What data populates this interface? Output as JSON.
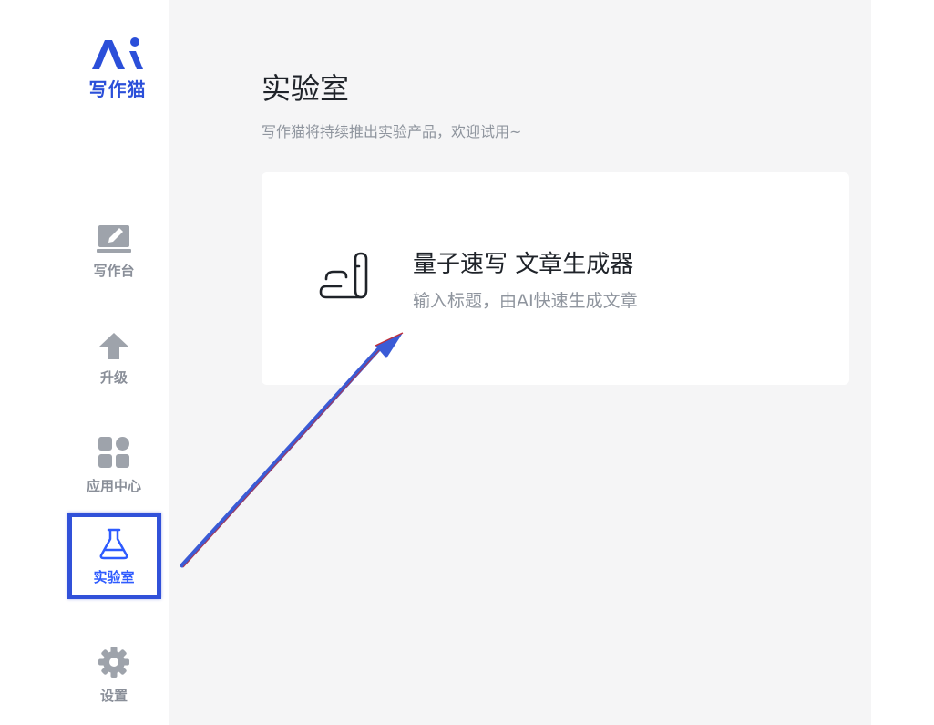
{
  "app": {
    "logo_text": "写作猫",
    "logo_mark": "AI"
  },
  "sidebar": {
    "items": [
      {
        "label": "写作台",
        "icon": "pencil-tablet-icon"
      },
      {
        "label": "升级",
        "icon": "up-arrow-icon"
      },
      {
        "label": "应用中心",
        "icon": "app-grid-icon"
      },
      {
        "label": "实验室",
        "icon": "flask-icon",
        "active": true
      },
      {
        "label": "设置",
        "icon": "gear-icon"
      }
    ]
  },
  "main": {
    "title": "实验室",
    "subtitle": "写作猫将持续推出实验产品，欢迎试用~",
    "card": {
      "title": "量子速写 文章生成器",
      "description": "输入标题，由AI快速生成文章",
      "icon": "quill-scroll-icon"
    }
  },
  "colors": {
    "brand": "#2b4fd9",
    "active": "#2e5bff",
    "highlight_border": "#3151d9",
    "arrow": "#3a5bd6",
    "muted": "#8a8f99"
  }
}
